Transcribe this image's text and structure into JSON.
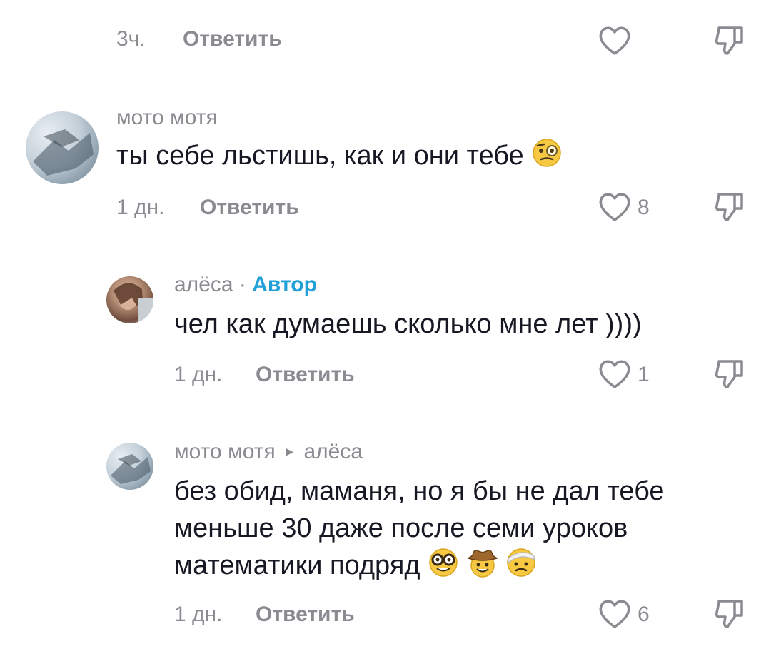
{
  "comments": [
    {
      "time": "3ч.",
      "reply_label": "Ответить",
      "likes": ""
    },
    {
      "author": "мото мотя",
      "text": "ты себе льстишь, как и они тебе",
      "time": "1 дн.",
      "reply_label": "Ответить",
      "likes": "8",
      "emoji": [
        "face-with-monocle"
      ]
    },
    {
      "author": "алёса",
      "author_separator": " · ",
      "author_badge": "Автор",
      "text": "чел как думаешь сколько мне лет ))))",
      "time": "1 дн.",
      "reply_label": "Ответить",
      "likes": "1"
    },
    {
      "author": "мото мотя",
      "reply_arrow": "▸",
      "reply_to": "алёса",
      "text_line1": "без обид, маманя, но я бы не дал тебе",
      "text_line2": "меньше 30 даже после семи уроков",
      "text_line3": "математики подряд",
      "time": "1 дн.",
      "reply_label": "Ответить",
      "likes": "6",
      "emoji": [
        "nerd-face",
        "cowboy-face",
        "face-with-head-bandage"
      ]
    }
  ],
  "colors": {
    "text": "#161823",
    "meta": "#8a8b91",
    "author_badge": "#20a0d6"
  }
}
